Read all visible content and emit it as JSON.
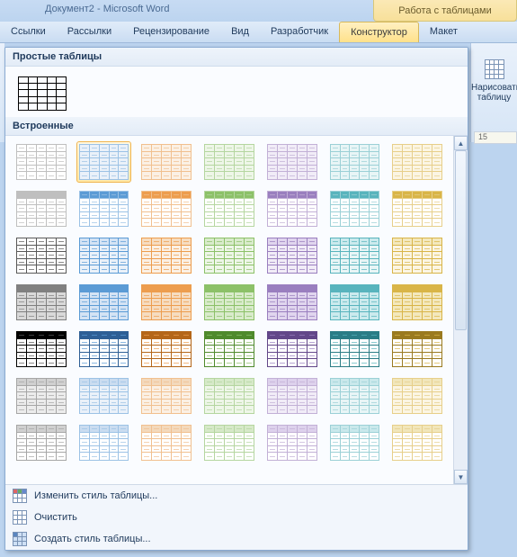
{
  "titlebar": {
    "document": "Документ2 - Microsoft Word",
    "context_tab": "Работа с таблицами"
  },
  "menu": {
    "items": [
      "Ссылки",
      "Рассылки",
      "Рецензирование",
      "Вид",
      "Разработчик",
      "Конструктор",
      "Макет"
    ],
    "active_index": 5
  },
  "right": {
    "draw_table": "Нарисовать таблицу",
    "ruler_text": "15"
  },
  "gallery": {
    "groups": {
      "simple": "Простые таблицы",
      "builtin": "Встроенные"
    },
    "selected_index": 1,
    "style_rows": [
      [
        {
          "name": "light-none",
          "border": "#bfbfbf",
          "fill": "#ffffff",
          "hdr": "#ffffff",
          "line": "#bfbfbf"
        },
        {
          "name": "light-blue",
          "border": "#9cc2e5",
          "fill": "#eaf1f9",
          "hdr": "#eaf1f9",
          "line": "#9cc2e5"
        },
        {
          "name": "light-orange",
          "border": "#f1c08f",
          "fill": "#fbf0e4",
          "hdr": "#fbf0e4",
          "line": "#f1c08f"
        },
        {
          "name": "light-green",
          "border": "#b5d6a0",
          "fill": "#eef6e8",
          "hdr": "#eef6e8",
          "line": "#b5d6a0"
        },
        {
          "name": "light-purple",
          "border": "#c2b0d6",
          "fill": "#f1ecf7",
          "hdr": "#f1ecf7",
          "line": "#c2b0d6"
        },
        {
          "name": "light-teal",
          "border": "#9bd0d6",
          "fill": "#e8f5f6",
          "hdr": "#e8f5f6",
          "line": "#9bd0d6"
        },
        {
          "name": "light-amber",
          "border": "#e7cf8a",
          "fill": "#fbf5e3",
          "hdr": "#fbf5e3",
          "line": "#e7cf8a"
        }
      ],
      [
        {
          "name": "hdr-gray",
          "border": "#bfbfbf",
          "fill": "#ffffff",
          "hdr": "#bfbfbf",
          "line": "#bfbfbf"
        },
        {
          "name": "hdr-blue",
          "border": "#9cc2e5",
          "fill": "#ffffff",
          "hdr": "#5b9bd5",
          "line": "#9cc2e5"
        },
        {
          "name": "hdr-orange",
          "border": "#f1c08f",
          "fill": "#ffffff",
          "hdr": "#ed9d4e",
          "line": "#f1c08f"
        },
        {
          "name": "hdr-green",
          "border": "#b5d6a0",
          "fill": "#ffffff",
          "hdr": "#8cc168",
          "line": "#b5d6a0"
        },
        {
          "name": "hdr-purple",
          "border": "#c2b0d6",
          "fill": "#ffffff",
          "hdr": "#9a7fbf",
          "line": "#c2b0d6"
        },
        {
          "name": "hdr-teal",
          "border": "#9bd0d6",
          "fill": "#ffffff",
          "hdr": "#58b4bd",
          "line": "#9bd0d6"
        },
        {
          "name": "hdr-amber",
          "border": "#e7cf8a",
          "fill": "#ffffff",
          "hdr": "#d9b548",
          "line": "#e7cf8a"
        }
      ],
      [
        {
          "name": "grid-gray",
          "border": "#595959",
          "fill": "#ffffff",
          "hdr": "#ffffff",
          "line": "#595959"
        },
        {
          "name": "grid-blue",
          "border": "#5b9bd5",
          "fill": "#eaf1f9",
          "hdr": "#d4e3f4",
          "line": "#5b9bd5"
        },
        {
          "name": "grid-orange",
          "border": "#ed9d4e",
          "fill": "#fbf0e4",
          "hdr": "#f6dcc0",
          "line": "#ed9d4e"
        },
        {
          "name": "grid-green",
          "border": "#8cc168",
          "fill": "#eef6e8",
          "hdr": "#d9ebcb",
          "line": "#8cc168"
        },
        {
          "name": "grid-purple",
          "border": "#9a7fbf",
          "fill": "#f1ecf7",
          "hdr": "#e0d5ee",
          "line": "#9a7fbf"
        },
        {
          "name": "grid-teal",
          "border": "#58b4bd",
          "fill": "#e8f5f6",
          "hdr": "#cbeaed",
          "line": "#58b4bd"
        },
        {
          "name": "grid-amber",
          "border": "#d9b548",
          "fill": "#fbf5e3",
          "hdr": "#f3e8bd",
          "line": "#d9b548"
        }
      ],
      [
        {
          "name": "fill-gray",
          "border": "#808080",
          "fill": "#d9d9d9",
          "hdr": "#808080",
          "line": "#808080"
        },
        {
          "name": "fill-blue",
          "border": "#5b9bd5",
          "fill": "#d4e3f4",
          "hdr": "#5b9bd5",
          "line": "#5b9bd5"
        },
        {
          "name": "fill-orange",
          "border": "#ed9d4e",
          "fill": "#f6dcc0",
          "hdr": "#ed9d4e",
          "line": "#ed9d4e"
        },
        {
          "name": "fill-green",
          "border": "#8cc168",
          "fill": "#d9ebcb",
          "hdr": "#8cc168",
          "line": "#8cc168"
        },
        {
          "name": "fill-purple",
          "border": "#9a7fbf",
          "fill": "#e0d5ee",
          "hdr": "#9a7fbf",
          "line": "#9a7fbf"
        },
        {
          "name": "fill-teal",
          "border": "#58b4bd",
          "fill": "#cbeaed",
          "hdr": "#58b4bd",
          "line": "#58b4bd"
        },
        {
          "name": "fill-amber",
          "border": "#d9b548",
          "fill": "#f3e8bd",
          "hdr": "#d9b548",
          "line": "#d9b548"
        }
      ],
      [
        {
          "name": "dark-black",
          "border": "#000000",
          "fill": "#ffffff",
          "hdr": "#000000",
          "line": "#595959"
        },
        {
          "name": "dark-blue",
          "border": "#2e5f95",
          "fill": "#ffffff",
          "hdr": "#2e5f95",
          "line": "#5b9bd5"
        },
        {
          "name": "dark-orange",
          "border": "#b46618",
          "fill": "#ffffff",
          "hdr": "#b46618",
          "line": "#ed9d4e"
        },
        {
          "name": "dark-green",
          "border": "#4f8a2c",
          "fill": "#ffffff",
          "hdr": "#4f8a2c",
          "line": "#8cc168"
        },
        {
          "name": "dark-purple",
          "border": "#634789",
          "fill": "#ffffff",
          "hdr": "#634789",
          "line": "#9a7fbf"
        },
        {
          "name": "dark-teal",
          "border": "#2b7d86",
          "fill": "#ffffff",
          "hdr": "#2b7d86",
          "line": "#58b4bd"
        },
        {
          "name": "dark-amber",
          "border": "#9a7a1f",
          "fill": "#ffffff",
          "hdr": "#9a7a1f",
          "line": "#d9b548"
        }
      ],
      [
        {
          "name": "stripe-gray",
          "border": "#a6a6a6",
          "fill": "#ececec",
          "hdr": "#d0d0d0",
          "line": "#a6a6a6"
        },
        {
          "name": "stripe-blue",
          "border": "#9cc2e5",
          "fill": "#eaf1f9",
          "hdr": "#cadcf0",
          "line": "#9cc2e5"
        },
        {
          "name": "stripe-orange",
          "border": "#f1c08f",
          "fill": "#fbf0e4",
          "hdr": "#f3d9bc",
          "line": "#f1c08f"
        },
        {
          "name": "stripe-green",
          "border": "#b5d6a0",
          "fill": "#eef6e8",
          "hdr": "#d6e9c8",
          "line": "#b5d6a0"
        },
        {
          "name": "stripe-purple",
          "border": "#c2b0d6",
          "fill": "#f1ecf7",
          "hdr": "#ddd1ec",
          "line": "#c2b0d6"
        },
        {
          "name": "stripe-teal",
          "border": "#9bd0d6",
          "fill": "#e8f5f6",
          "hdr": "#c9e8eb",
          "line": "#9bd0d6"
        },
        {
          "name": "stripe-amber",
          "border": "#e7cf8a",
          "fill": "#fbf5e3",
          "hdr": "#f1e6bb",
          "line": "#e7cf8a"
        }
      ],
      [
        {
          "name": "stripe2-gray",
          "border": "#a6a6a6",
          "fill": "#ffffff",
          "hdr": "#d0d0d0",
          "line": "#a6a6a6"
        },
        {
          "name": "stripe2-blue",
          "border": "#9cc2e5",
          "fill": "#ffffff",
          "hdr": "#cadcf0",
          "line": "#9cc2e5"
        },
        {
          "name": "stripe2-orange",
          "border": "#f1c08f",
          "fill": "#ffffff",
          "hdr": "#f3d9bc",
          "line": "#f1c08f"
        },
        {
          "name": "stripe2-green",
          "border": "#b5d6a0",
          "fill": "#ffffff",
          "hdr": "#d6e9c8",
          "line": "#b5d6a0"
        },
        {
          "name": "stripe2-purple",
          "border": "#c2b0d6",
          "fill": "#ffffff",
          "hdr": "#ddd1ec",
          "line": "#c2b0d6"
        },
        {
          "name": "stripe2-teal",
          "border": "#9bd0d6",
          "fill": "#ffffff",
          "hdr": "#c9e8eb",
          "line": "#9bd0d6"
        },
        {
          "name": "stripe2-amber",
          "border": "#e7cf8a",
          "fill": "#ffffff",
          "hdr": "#f1e6bb",
          "line": "#e7cf8a"
        }
      ]
    ],
    "footer": {
      "modify": "Изменить стиль таблицы...",
      "clear": "Очистить",
      "new": "Создать стиль таблицы..."
    }
  }
}
